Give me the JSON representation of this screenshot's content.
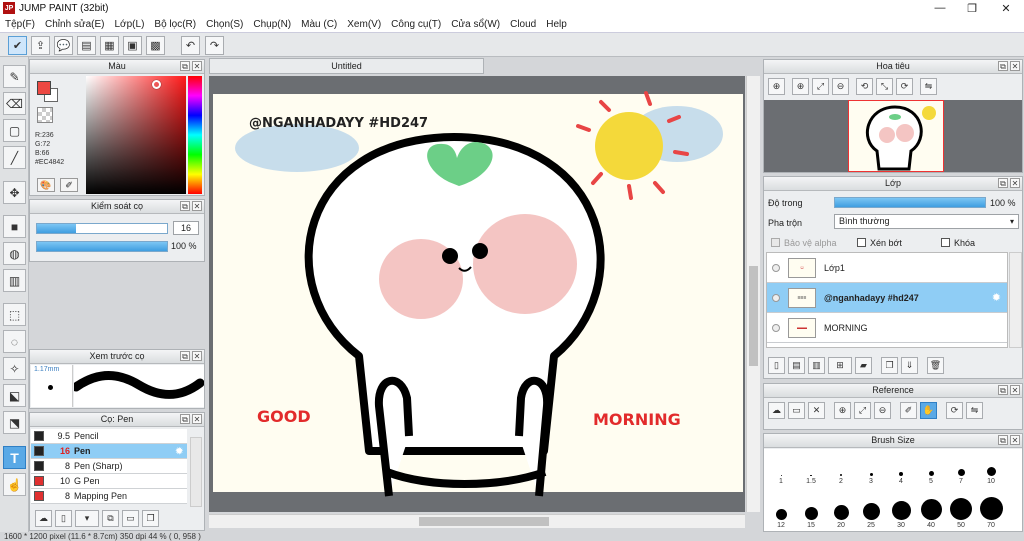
{
  "window": {
    "title": "JUMP PAINT (32bit)",
    "app_icon": "JP"
  },
  "menu": [
    "Tệp(F)",
    "Chỉnh sửa(E)",
    "Lớp(L)",
    "Bộ lọc(R)",
    "Chọn(S)",
    "Chụp(N)",
    "Màu (C)",
    "Xem(V)",
    "Công cụ(T)",
    "Cửa sổ(W)",
    "Cloud",
    "Help"
  ],
  "color_panel": {
    "title": "Màu",
    "r": "R:236",
    "g": "G:72",
    "b": "B:66",
    "hex": "#EC4842",
    "primary": "#ec4842",
    "secondary": "#ffffff"
  },
  "brush_control": {
    "title": "Kiểm soát cọ",
    "size": "16",
    "opacity": "100 %",
    "size_fraction": 0.3,
    "opacity_fraction": 1.0
  },
  "brush_preview": {
    "title": "Xem trước cọ",
    "size_label": "1.17mm"
  },
  "brush_list": {
    "title": "Cọ: Pen",
    "items": [
      {
        "size": "9.5",
        "name": "Pencil",
        "color": "#222222"
      },
      {
        "size": "16",
        "name": "Pen",
        "color": "#222222"
      },
      {
        "size": "8",
        "name": "Pen (Sharp)",
        "color": "#222222"
      },
      {
        "size": "10",
        "name": "G Pen",
        "color": "#e03030"
      },
      {
        "size": "8",
        "name": "Mapping Pen",
        "color": "#e03030"
      }
    ]
  },
  "document": {
    "tab_title": "Untitled"
  },
  "artwork": {
    "watermark": "@NGANHADAYY #HD247",
    "left_text": "GOOD",
    "right_text": "MORNING"
  },
  "navigator": {
    "title": "Hoa tiêu"
  },
  "layer_panel": {
    "title": "Lớp",
    "opacity_label": "Độ trong",
    "opacity_value": "100 %",
    "blend_label": "Pha trộn",
    "blend_value": "Bình thường",
    "protect_alpha": "Bảo vệ alpha",
    "clipping": "Xén bớt",
    "lock": "Khóa",
    "layers": [
      {
        "name": "Lớp1"
      },
      {
        "name": "@nganhadayy #hd247"
      },
      {
        "name": "MORNING"
      }
    ]
  },
  "reference": {
    "title": "Reference"
  },
  "brush_size": {
    "title": "Brush Size",
    "row1": [
      "1",
      "1.5",
      "2",
      "3",
      "4",
      "5",
      "7",
      "10"
    ],
    "row2": [
      "12",
      "15",
      "20",
      "25",
      "30",
      "40",
      "50",
      "70"
    ]
  },
  "status": {
    "text": "1600 * 1200 pixel   (11.6 * 8.7cm)   350 dpi   44 %   ( 0, 958 )"
  },
  "colors": {
    "accent": "#5aa9e6",
    "canvas_bg": "#fffdf1",
    "text_red": "#e22b2b"
  }
}
